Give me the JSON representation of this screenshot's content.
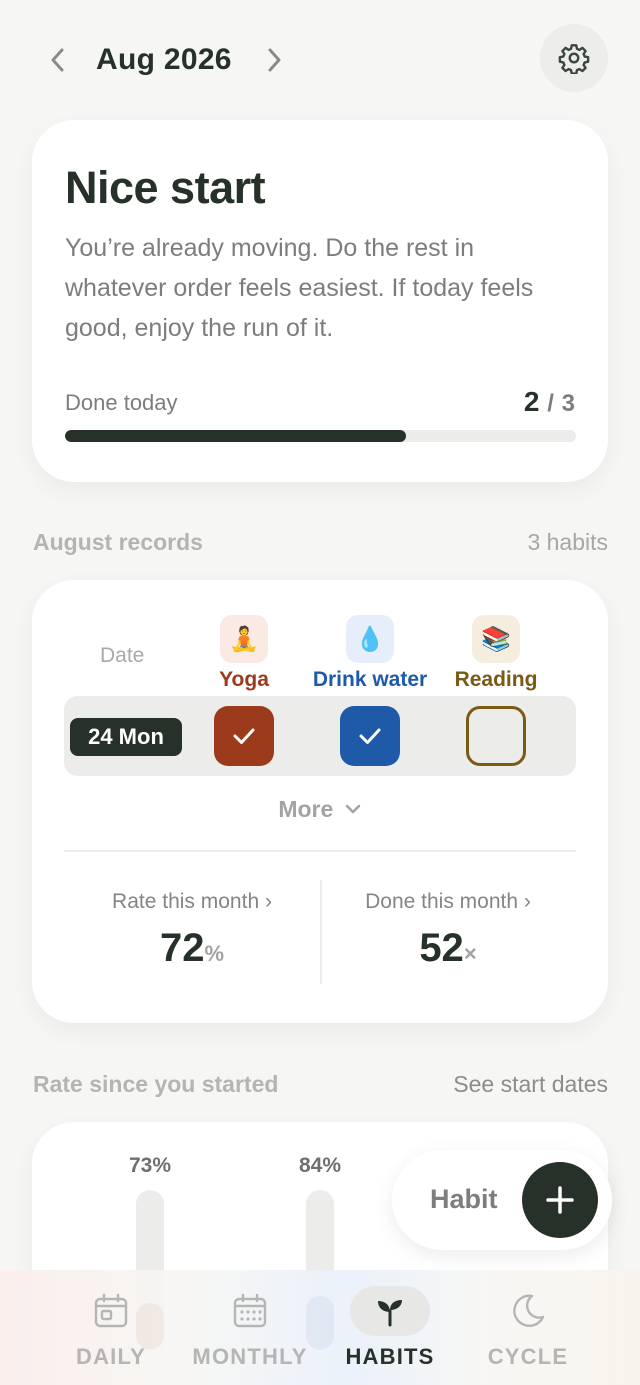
{
  "header": {
    "month": "Aug 2026",
    "prev_icon": "chevron-left-icon",
    "next_icon": "chevron-right-icon",
    "settings_icon": "gear-icon"
  },
  "summary": {
    "title": "Nice start",
    "message": "You’re already moving. Do the rest in whatever order feels easiest. If today feels good, enjoy the run of it.",
    "done_label": "Done today",
    "done": "2",
    "separator": "/",
    "total": "3",
    "progress_fraction": 0.667
  },
  "records": {
    "section_title": "August records",
    "habit_count": "3 habits",
    "date_header": "Date",
    "habits": [
      {
        "name": "Yoga",
        "icon": "🧘",
        "color": "#9b3b1b",
        "icon_bg": "#fbe9e4",
        "checked": true
      },
      {
        "name": "Drink water",
        "icon": "💧",
        "color": "#1e5aa8",
        "icon_bg": "#e6eefb",
        "checked": true
      },
      {
        "name": "Reading",
        "icon": "📚",
        "color": "#7a5a14",
        "icon_bg": "#f5eedf",
        "checked": false
      }
    ],
    "row_date": "24 Mon",
    "more_label": "More",
    "rate_label": "Rate this month",
    "rate_value": "72",
    "rate_unit": "%",
    "done_label": "Done this month",
    "done_value": "52",
    "done_unit": "×"
  },
  "rate_since": {
    "section_title": "Rate since you started",
    "link": "See start dates",
    "bars": [
      {
        "label": "73%",
        "value": 73,
        "color": "#9b3b1b"
      },
      {
        "label": "84%",
        "value": 84,
        "color": "#1e5aa8"
      }
    ]
  },
  "fab": {
    "label": "Habit",
    "icon": "plus-icon"
  },
  "bottom_nav": {
    "tabs": [
      {
        "label": "DAILY",
        "icon": "calendar-day-icon"
      },
      {
        "label": "MONTHLY",
        "icon": "calendar-month-icon"
      },
      {
        "label": "HABITS",
        "icon": "sprout-icon",
        "active": true
      },
      {
        "label": "CYCLE",
        "icon": "moon-icon"
      }
    ]
  }
}
